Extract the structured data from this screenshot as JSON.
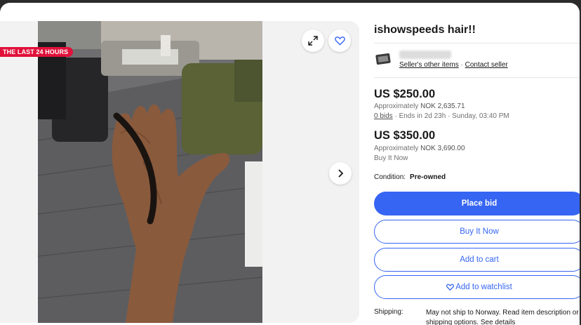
{
  "badge": {
    "text": "THE LAST 24 HOURS"
  },
  "listing": {
    "title": "ishowspeeds hair!!"
  },
  "seller": {
    "other_items_link": "Seller's other items",
    "separator": "·",
    "contact_link": "Contact seller"
  },
  "auction": {
    "price": "US $250.00",
    "approx_prefix": "Approximately",
    "approx_value": "NOK 2,635.71",
    "bids_link": "0 bids",
    "ends_text": "· Ends in 2d 23h · Sunday, 03:40 PM"
  },
  "buy_now": {
    "price": "US $350.00",
    "approx_prefix": "Approximately",
    "approx_value": "NOK 3,690.00",
    "label": "Buy It Now"
  },
  "condition": {
    "label": "Condition:",
    "value": "Pre-owned"
  },
  "buttons": {
    "place_bid": "Place bid",
    "buy_it_now": "Buy It Now",
    "add_to_cart": "Add to cart",
    "add_to_watchlist": "Add to watchlist"
  },
  "shipping": {
    "label": "Shipping:",
    "line1": "May not ship to Norway. Read item description or",
    "line2_prefix": "shipping options.",
    "see_details_link": "See details"
  },
  "colors": {
    "accent": "#3665f3",
    "badge": "#e0103a"
  },
  "icons": [
    "expand-icon",
    "heart-icon",
    "chevron-right-icon",
    "seller-avatar-icon"
  ]
}
